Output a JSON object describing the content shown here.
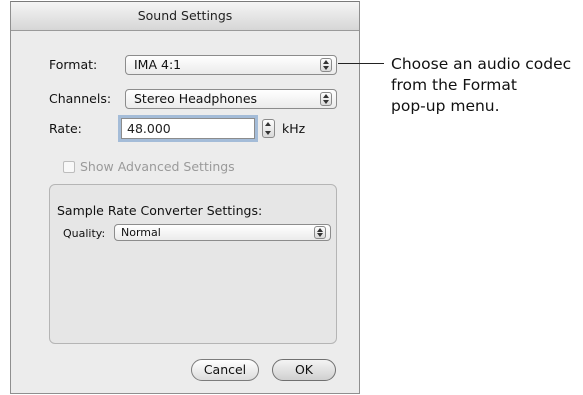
{
  "window": {
    "title": "Sound Settings"
  },
  "format": {
    "label": "Format:",
    "value": "IMA 4:1"
  },
  "channels": {
    "label": "Channels:",
    "value": "Stereo Headphones"
  },
  "rate": {
    "label": "Rate:",
    "value": "48.000",
    "unit": "kHz"
  },
  "advanced": {
    "label": "Show Advanced Settings",
    "checked": false
  },
  "src_group": {
    "title": "Sample Rate Converter Settings:",
    "quality_label": "Quality:",
    "quality_value": "Normal"
  },
  "buttons": {
    "cancel": "Cancel",
    "ok": "OK"
  },
  "callout": {
    "line1": "Choose an audio codec",
    "line2": "from the Format",
    "line3": "pop-up menu."
  }
}
